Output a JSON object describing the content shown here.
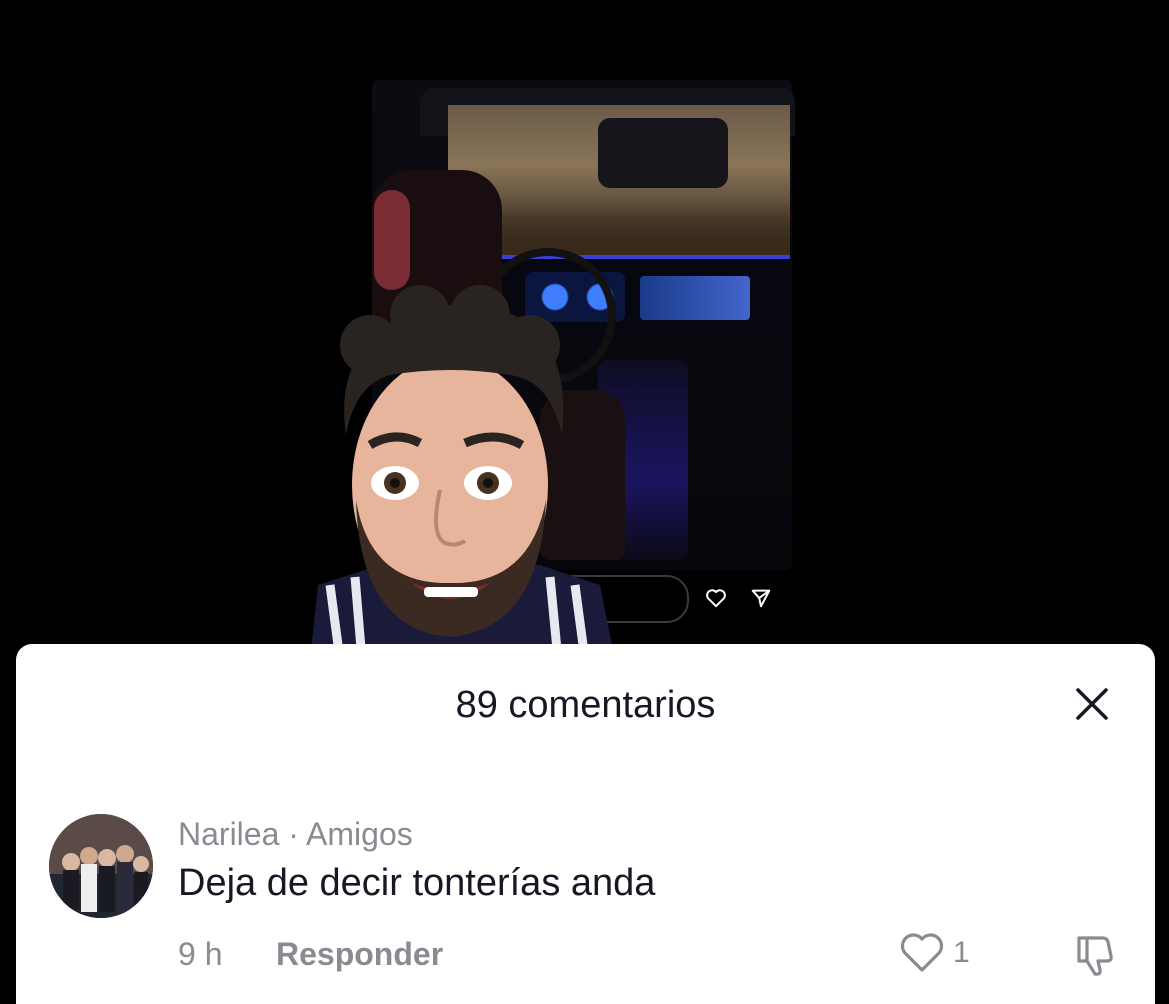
{
  "sheet": {
    "title": "89 comentarios"
  },
  "comment": {
    "author": "Narilea · Amigos",
    "text": "Deja de decir tonterías anda",
    "time": "9 h",
    "reply_label": "Responder",
    "like_count": "1"
  },
  "icons": {
    "close": "close-icon",
    "heart": "heart-icon",
    "dislike": "thumbs-down-icon",
    "share": "send-icon"
  },
  "colors": {
    "sheet_bg": "#ffffff",
    "text_primary": "#161823",
    "text_secondary": "#8a8b91"
  }
}
